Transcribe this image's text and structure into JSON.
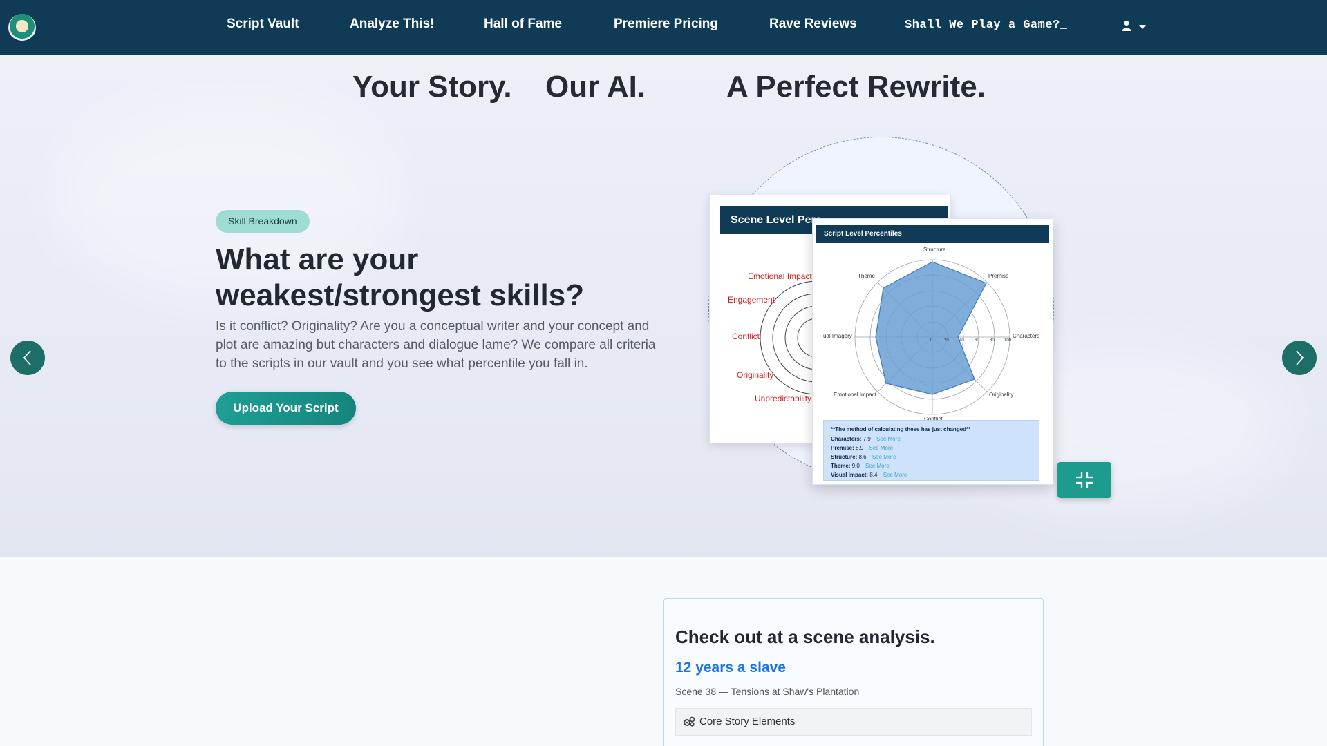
{
  "nav": {
    "items": [
      "Script Vault",
      "Analyze This!",
      "Hall of Fame",
      "Premiere Pricing",
      "Rave Reviews"
    ],
    "game": "Shall We Play a Game?_"
  },
  "hero": {
    "tagline": [
      "Your Story.",
      "Our AI.",
      "A Perfect Rewrite."
    ],
    "pill": "Skill Breakdown",
    "heading": "What are your weakest/strongest skills?",
    "description": "Is it conflict? Originality? Are you a conceptual writer and your concept and plot are amazing but characters and dialogue lame? We compare all criteria to the scripts in our vault and you see what percentile you fall in.",
    "cta": "Upload Your Script"
  },
  "scene_card": {
    "title": "Scene Level Perc",
    "labels": [
      "Emotional Impact",
      "Engagement",
      "Conflict",
      "Originality",
      "Unpredictability"
    ]
  },
  "script_card": {
    "title": "Script Level Percentiles",
    "axes": [
      "Structure",
      "Premise",
      "Characters",
      "Originality",
      "Conflict",
      "Emotional Impact",
      "ual Imagery",
      "Theme"
    ],
    "ticks": [
      "0",
      "20",
      "40",
      "60",
      "80",
      "100"
    ],
    "note_title": "**The method of calculating these has just changed**",
    "rows": [
      {
        "label": "Characters:",
        "value": "7.9"
      },
      {
        "label": "Premise:",
        "value": "8.9"
      },
      {
        "label": "Structure:",
        "value": "8.6"
      },
      {
        "label": "Theme:",
        "value": "9.0"
      },
      {
        "label": "Visual Impact:",
        "value": "8.4"
      }
    ],
    "see_more": "See More"
  },
  "analysis": {
    "title": "Check out at a scene analysis.",
    "movie": "12 years a slave",
    "scene": "Scene 38 — Tensions at Shaw's Plantation",
    "section": "Core Story Elements"
  },
  "colors": {
    "nav": "#0f3b57",
    "accent": "#1d9b8f",
    "link": "#1a73e8"
  }
}
